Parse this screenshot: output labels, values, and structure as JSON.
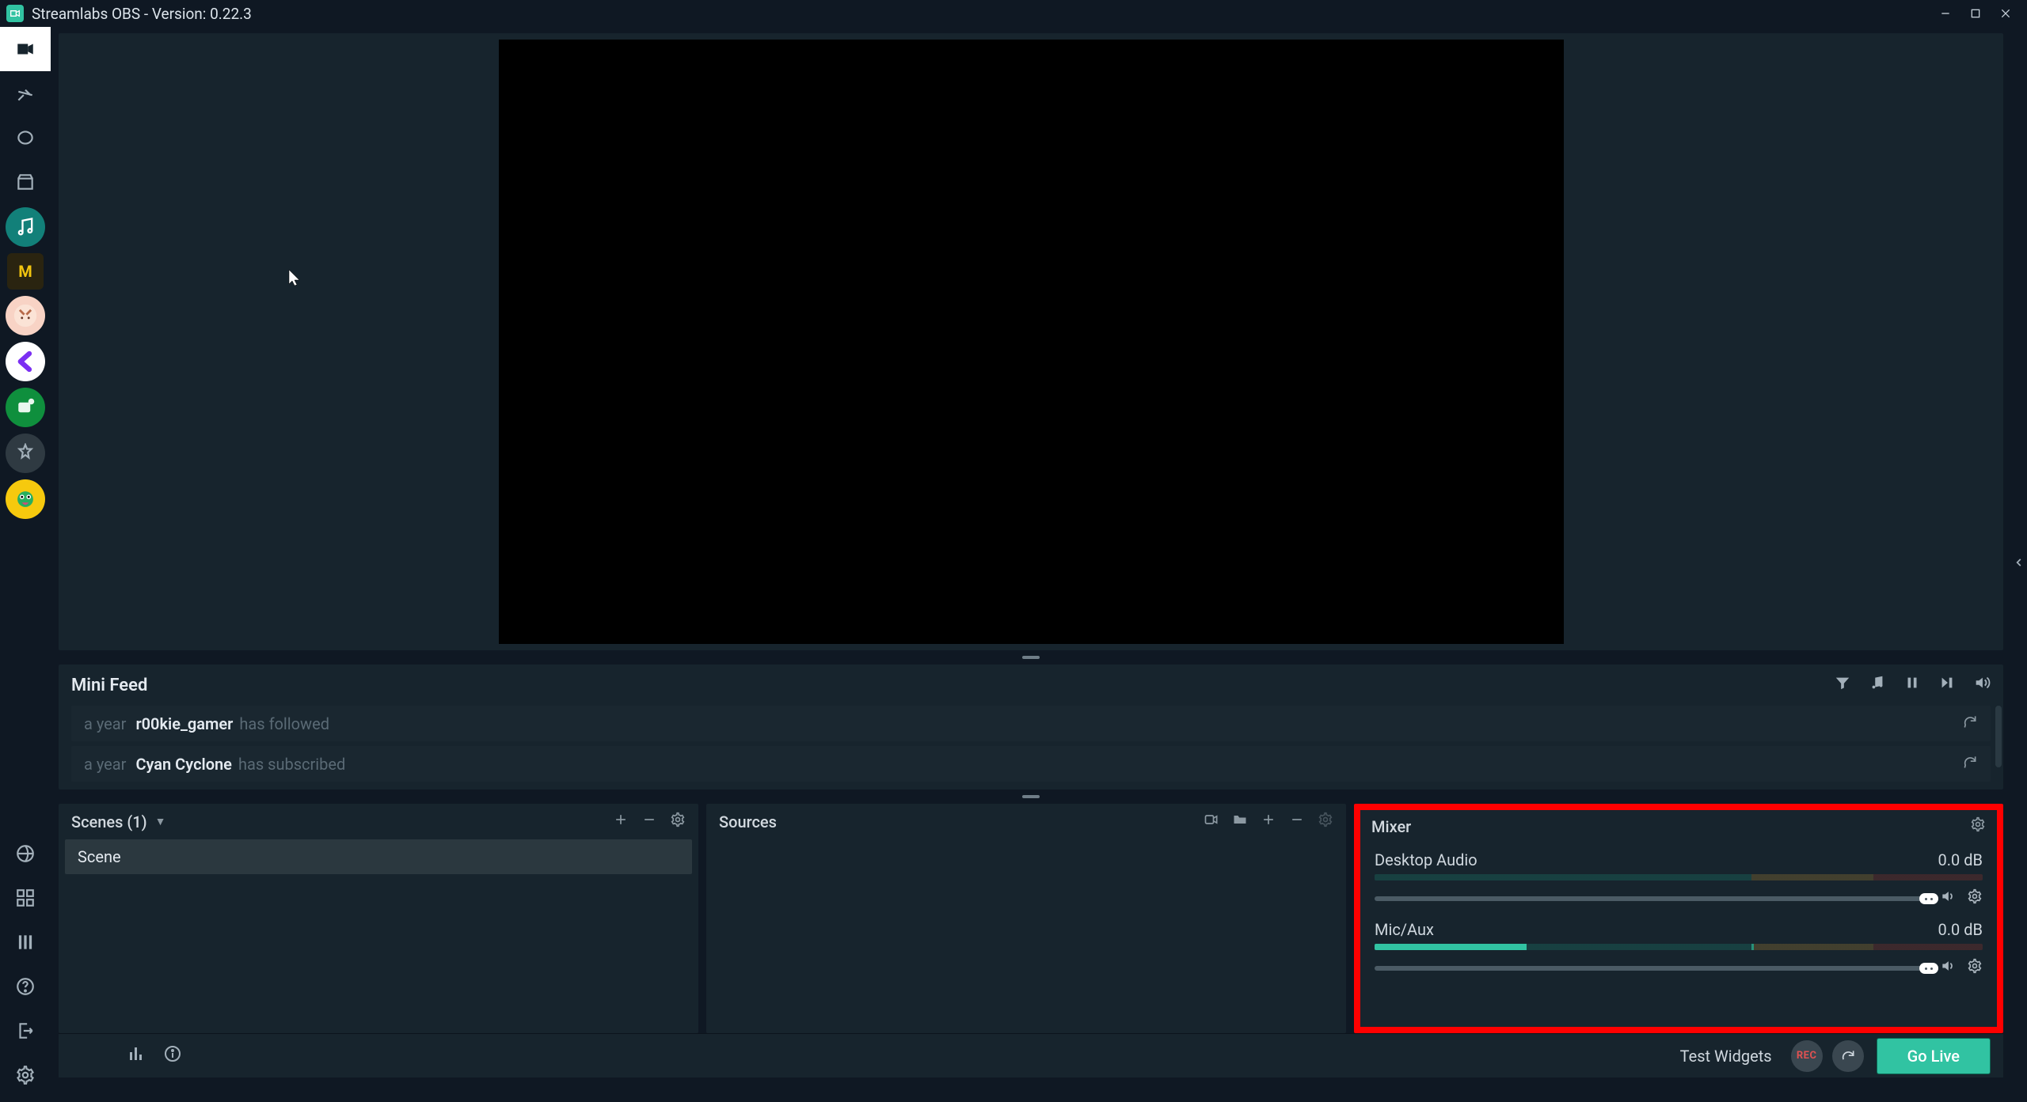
{
  "app": {
    "title": "Streamlabs OBS - Version: 0.22.3"
  },
  "minifeed": {
    "title": "Mini Feed",
    "rows": [
      {
        "time": "a year",
        "user": "r00kie_gamer",
        "action": "has followed"
      },
      {
        "time": "a year",
        "user": "Cyan Cyclone",
        "action": "has subscribed"
      }
    ]
  },
  "scenes": {
    "title": "Scenes (1)",
    "items": [
      "Scene"
    ]
  },
  "sources": {
    "title": "Sources"
  },
  "mixer": {
    "title": "Mixer",
    "channels": [
      {
        "name": "Desktop Audio",
        "db": "0.0 dB",
        "level_pct": 0,
        "peak_pct": 0,
        "slider_pct": 100
      },
      {
        "name": "Mic/Aux",
        "db": "0.0 dB",
        "level_pct": 25,
        "peak_pct": 62,
        "slider_pct": 100
      }
    ]
  },
  "statusbar": {
    "test_widgets_label": "Test Widgets",
    "rec_label": "REC",
    "go_live_label": "Go Live"
  },
  "highlight": {
    "target": "mixer-panel",
    "color": "#ff0000"
  }
}
